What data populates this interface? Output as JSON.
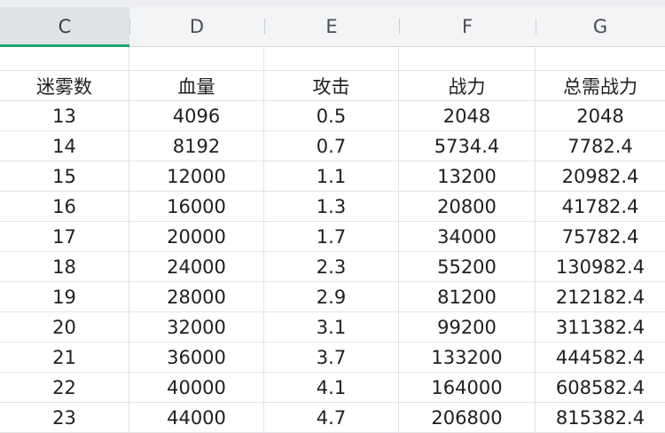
{
  "columns": [
    {
      "letter": "C",
      "selected": true
    },
    {
      "letter": "D",
      "selected": false
    },
    {
      "letter": "E",
      "selected": false
    },
    {
      "letter": "F",
      "selected": false
    },
    {
      "letter": "G",
      "selected": false
    }
  ],
  "table": {
    "headers": [
      "迷雾数",
      "血量",
      "攻击",
      "战力",
      "总需战力"
    ],
    "rows": [
      [
        "13",
        "4096",
        "0.5",
        "2048",
        "2048"
      ],
      [
        "14",
        "8192",
        "0.7",
        "5734.4",
        "7782.4"
      ],
      [
        "15",
        "12000",
        "1.1",
        "13200",
        "20982.4"
      ],
      [
        "16",
        "16000",
        "1.3",
        "20800",
        "41782.4"
      ],
      [
        "17",
        "20000",
        "1.7",
        "34000",
        "75782.4"
      ],
      [
        "18",
        "24000",
        "2.3",
        "55200",
        "130982.4"
      ],
      [
        "19",
        "28000",
        "2.9",
        "81200",
        "212182.4"
      ],
      [
        "20",
        "32000",
        "3.1",
        "99200",
        "311382.4"
      ],
      [
        "21",
        "36000",
        "3.7",
        "133200",
        "444582.4"
      ],
      [
        "22",
        "40000",
        "4.1",
        "164000",
        "608582.4"
      ],
      [
        "23",
        "44000",
        "4.7",
        "206800",
        "815382.4"
      ]
    ]
  },
  "colors": {
    "selected_accent": "#1ea56a",
    "header_bg": "#f3f4f6",
    "grid_line": "#e2e4e7"
  }
}
